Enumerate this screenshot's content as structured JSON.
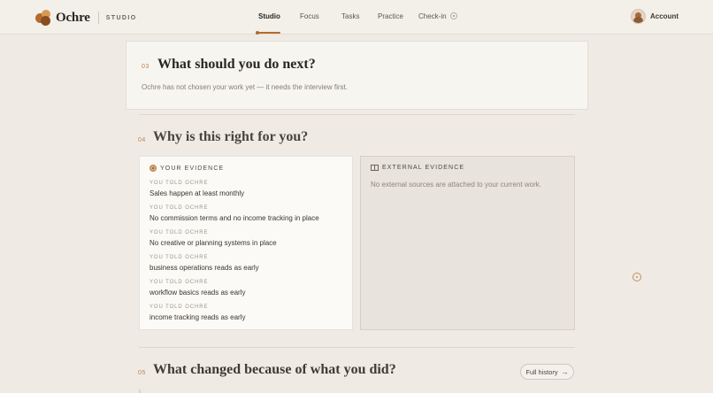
{
  "brand": {
    "name": "Ochre",
    "sub": "STUDIO"
  },
  "nav": {
    "items": [
      {
        "label": "Studio",
        "active": true
      },
      {
        "label": "Focus",
        "active": false
      },
      {
        "label": "Tasks",
        "active": false
      },
      {
        "label": "Practice",
        "active": false
      },
      {
        "label": "Check-in",
        "active": false
      }
    ],
    "account_label": "Account"
  },
  "section03": {
    "num": "03",
    "title": "What should you do next?",
    "desc": "Ochre has not chosen your work yet — it needs the interview first."
  },
  "section04": {
    "num": "04",
    "title": "Why is this right for you?",
    "your_evidence": {
      "heading": "YOUR EVIDENCE",
      "items": [
        {
          "kicker": "YOU TOLD OCHRE",
          "text": "Sales happen at least monthly"
        },
        {
          "kicker": "YOU TOLD OCHRE",
          "text": "No commission terms and no income tracking in place"
        },
        {
          "kicker": "YOU TOLD OCHRE",
          "text": "No creative or planning systems in place"
        },
        {
          "kicker": "YOU TOLD OCHRE",
          "text": "business operations reads as early"
        },
        {
          "kicker": "YOU TOLD OCHRE",
          "text": "workflow basics reads as early"
        },
        {
          "kicker": "YOU TOLD OCHRE",
          "text": "income tracking reads as early"
        }
      ]
    },
    "external_evidence": {
      "heading": "EXTERNAL EVIDENCE",
      "empty": "No external sources are attached to your current work."
    }
  },
  "section05": {
    "num": "05",
    "title": "What changed because of what you did?",
    "history_button": "Full history",
    "history_arrow": "→"
  },
  "colors": {
    "accent": "#b36a2c",
    "background": "#efebe4",
    "card": "#f7f5f0"
  }
}
